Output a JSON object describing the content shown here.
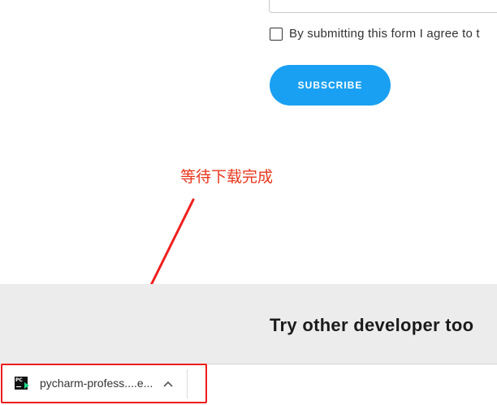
{
  "form": {
    "consent_text": "By submitting this form I agree to t",
    "subscribe_label": "SUBSCRIBE"
  },
  "annotation": {
    "text": "等待下载完成",
    "color": "#e8361c"
  },
  "section": {
    "heading": "Try other developer too"
  },
  "download_bar": {
    "file_name": "pycharm-profess....e...",
    "file_icon": "pycharm-icon",
    "chevron_icon": "chevron-up-icon"
  },
  "colors": {
    "accent": "#1aa0f2",
    "annotation_red": "#ee1c1c",
    "band_gray": "#ececed"
  }
}
